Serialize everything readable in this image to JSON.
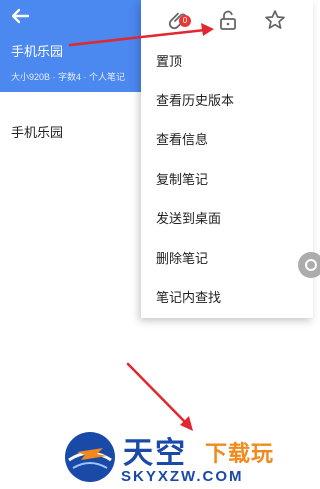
{
  "header": {
    "title": "手机乐园",
    "meta": "大小920B · 字数4 · 个人笔记"
  },
  "note_body": "手机乐园",
  "menu": {
    "attachment_badge": "0",
    "items": [
      {
        "label": "置顶"
      },
      {
        "label": "查看历史版本"
      },
      {
        "label": "查看信息"
      },
      {
        "label": "复制笔记"
      },
      {
        "label": "发送到桌面"
      },
      {
        "label": "删除笔记"
      },
      {
        "label": "笔记内查找"
      }
    ]
  },
  "icons": {
    "back": "arrow-left-icon",
    "attachment": "paperclip-icon",
    "lock": "unlock-icon",
    "star": "star-icon"
  },
  "colors": {
    "header_bg": "#4b88f0",
    "annotation_arrow": "#e0282e",
    "badge": "#e53935"
  },
  "watermark": {
    "cn_primary": "天空",
    "cn_secondary": "下载玩",
    "en": "SKYXZW.COM"
  }
}
